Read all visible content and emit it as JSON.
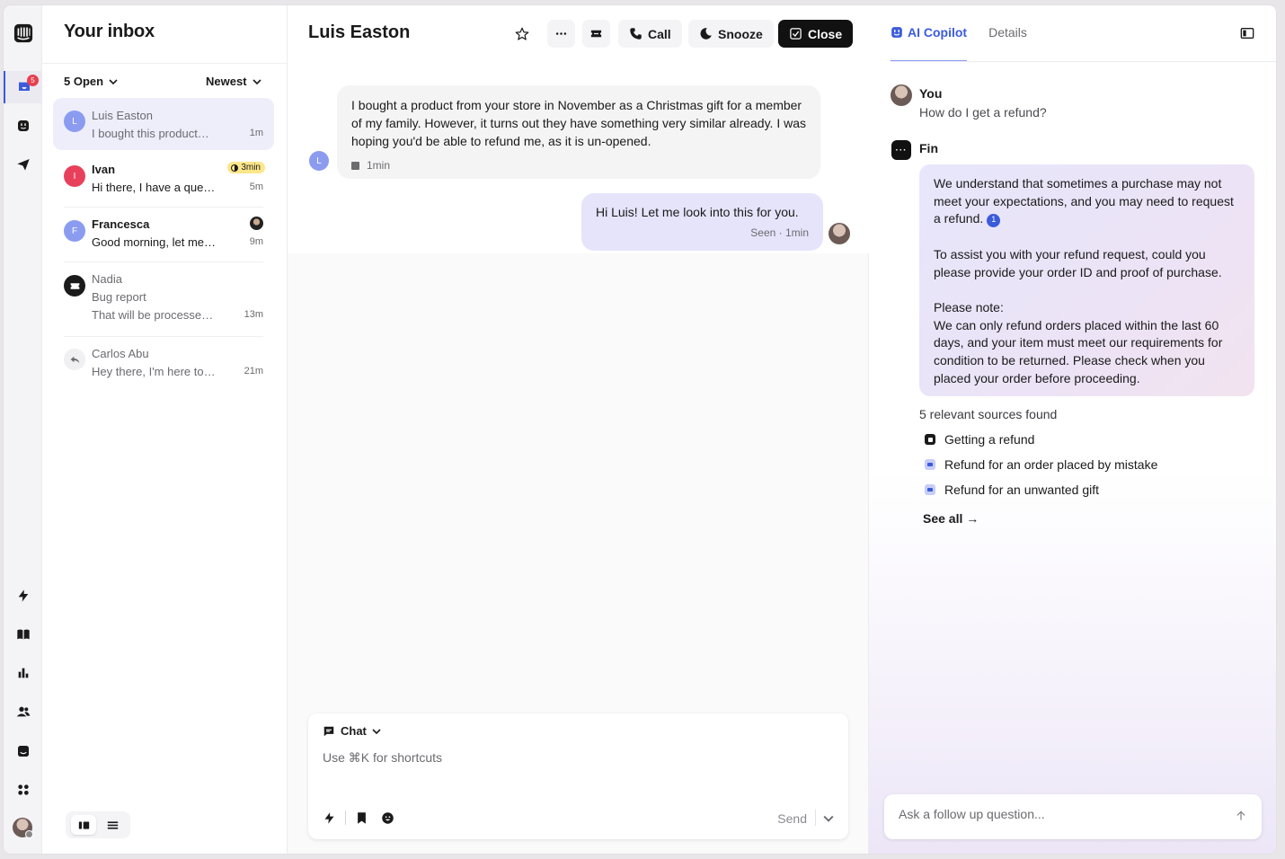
{
  "rail": {
    "inbox_badge": "5"
  },
  "inbox": {
    "title": "Your inbox",
    "filter_open": "5 Open",
    "filter_sort": "Newest",
    "conversations": [
      {
        "initial": "L",
        "name": "Luis Easton",
        "snippet": "I bought this product…",
        "time": "1m",
        "color": "#8b9cf0"
      },
      {
        "initial": "I",
        "name": "Ivan",
        "snippet": "Hi there, I have a que…",
        "time": "5m",
        "sla": "3min",
        "color": "#e8405a"
      },
      {
        "initial": "F",
        "name": "Francesca",
        "snippet": "Good morning, let me…",
        "time": "9m",
        "color": "#8b9cf0"
      },
      {
        "name": "Nadia",
        "subject": "Bug report",
        "snippet": "That will be processe…",
        "time": "13m"
      },
      {
        "name": "Carlos Abu",
        "snippet": "Hey there, I'm here to…",
        "time": "21m"
      }
    ]
  },
  "conversation": {
    "title": "Luis Easton",
    "buttons": {
      "call": "Call",
      "snooze": "Snooze",
      "close": "Close"
    },
    "messages": [
      {
        "from": "customer",
        "avatar": "L",
        "text": "I bought a product from your store in November as a Christmas gift for a member of my family. However, it turns out they have something very similar already. I was hoping you'd be able to refund me, as it is un-opened.",
        "meta": "1min"
      },
      {
        "from": "agent",
        "text": "Hi Luis! Let me look into this for you.",
        "meta": "Seen · 1min"
      }
    ],
    "composer": {
      "mode": "Chat",
      "placeholder": "Use ⌘K for shortcuts",
      "send": "Send"
    }
  },
  "copilot": {
    "tabs": [
      "AI Copilot",
      "Details"
    ],
    "user_name": "You",
    "user_question": "How do I get a refund?",
    "bot_avatar": "···",
    "bot_name": "Fin",
    "answer": {
      "p1": "We understand that sometimes a purchase may not meet your expectations, and you may need to request a refund.",
      "cite": "1",
      "p2": "To assist you with your refund request, could you please provide your order ID and proof of purchase.",
      "p3_title": "Please note:",
      "p3": "We can only refund orders placed within the last 60 days, and your item must meet our requirements for condition to be returned. Please check when you placed your order before proceeding."
    },
    "sources_title": "5 relevant sources found",
    "sources": [
      {
        "label": "Getting a refund",
        "icon": "article-icon"
      },
      {
        "label": "Refund for an order placed by mistake",
        "icon": "conversation-icon"
      },
      {
        "label": "Refund for an unwanted gift",
        "icon": "conversation-icon"
      }
    ],
    "see_all": "See all →",
    "followup_placeholder": "Ask a follow up question..."
  },
  "colors": {
    "accent": "#3b5bdb",
    "sla": "#fde68a",
    "close_button": "#111111"
  }
}
